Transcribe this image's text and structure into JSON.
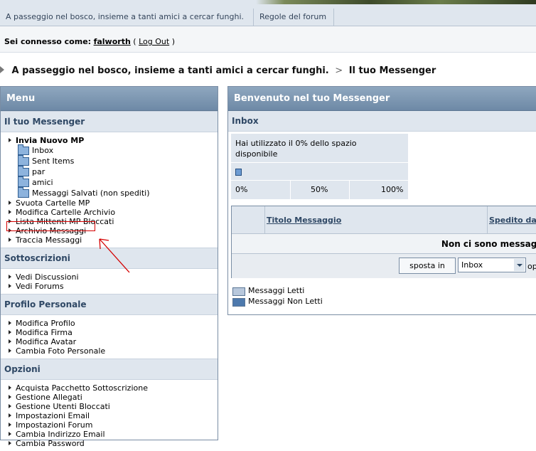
{
  "nav": {
    "tabs": [
      "A passeggio nel bosco, insieme a tanti amici a cercar funghi.",
      "Regole del forum"
    ]
  },
  "login": {
    "prefix": "Sei connesso come:",
    "username": "falworth",
    "open_paren": "(",
    "logout": "Log Out",
    "close_paren": ")"
  },
  "breadcrumb": {
    "forum": "A passeggio nel bosco, insieme a tanti amici a cercar funghi.",
    "separator": ">",
    "current": "Il tuo Messenger"
  },
  "menu": {
    "title": "Menu",
    "sections": {
      "messenger": {
        "title": "Il tuo Messenger",
        "send": "Invia Nuovo MP",
        "folders": [
          "Inbox",
          "Sent Items",
          "par",
          "amici",
          "Messaggi Salvati (non spediti)"
        ],
        "items": [
          "Svuota Cartelle MP",
          "Modifica Cartelle Archivio",
          "Lista Mittenti MP Bloccati",
          "Archivio Messaggi",
          "Traccia Messaggi"
        ]
      },
      "subscriptions": {
        "title": "Sottoscrizioni",
        "items": [
          "Vedi Discussioni",
          "Vedi Forums"
        ]
      },
      "profile": {
        "title": "Profilo Personale",
        "items": [
          "Modifica Profilo",
          "Modifica Firma",
          "Modifica Avatar",
          "Cambia Foto Personale"
        ]
      },
      "options": {
        "title": "Opzioni",
        "items": [
          "Acquista Pacchetto Sottoscrizione",
          "Gestione Allegati",
          "Gestione Utenti Bloccati",
          "Impostazioni Email",
          "Impostazioni Forum",
          "Cambia Indirizzo Email",
          "Cambia Password"
        ]
      }
    }
  },
  "messenger": {
    "title": "Benvenuto nel tuo Messenger",
    "inbox_title": "Inbox",
    "usage_text": "Hai utilizzato il 0% dello spazio disponibile",
    "usage_fraction": 0.0,
    "scale": [
      "0%",
      "50%",
      "100%"
    ],
    "columns": [
      "Titolo Messaggio",
      "Spedito da"
    ],
    "empty": "Non ci sono messaggi",
    "move_button": "sposta in",
    "move_target": "Inbox",
    "after_select": "op",
    "legend": [
      "Messaggi Letti",
      "Messaggi Non Letti"
    ]
  },
  "colors": {
    "header": "#7b93ad",
    "section_bg": "#dfe6ee",
    "highlight": "#d40000"
  }
}
